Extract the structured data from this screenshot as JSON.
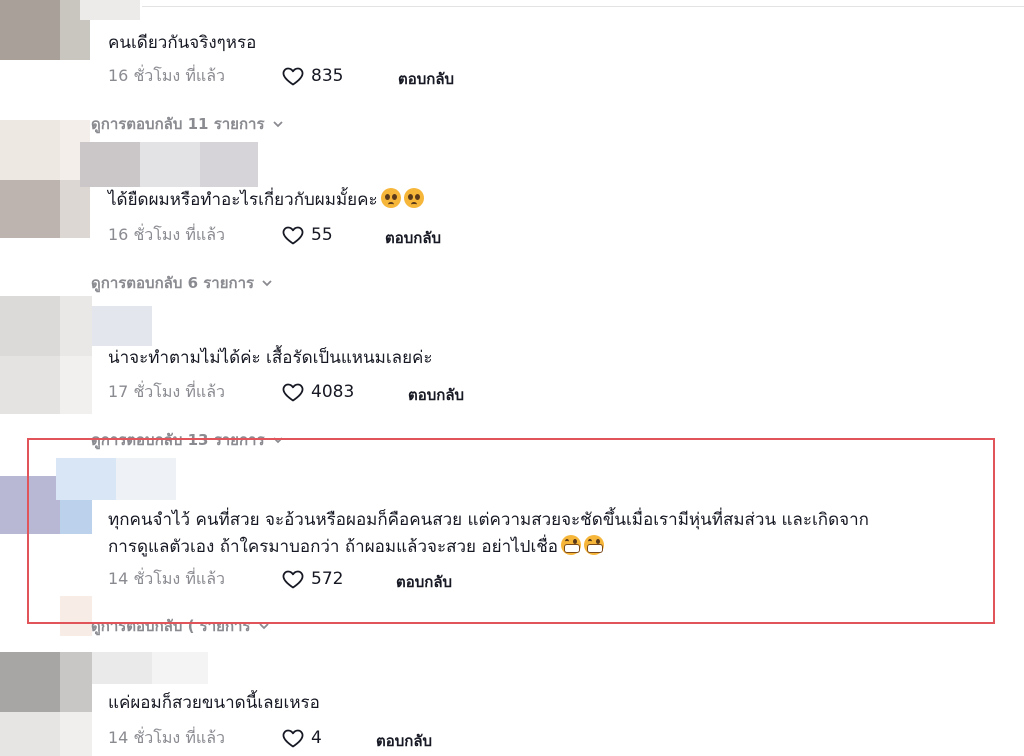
{
  "comments": [
    {
      "text": "คนเดียวกันจริงๆหรอ",
      "time": "16 ชั่วโมง ที่แล้ว",
      "likes": "835",
      "reply_label": "ตอบกลับ",
      "view_replies": "ดูการตอบกลับ 11 รายการ"
    },
    {
      "text": "ได้ยืดผมหรือทำอะไรเกี่ยวกับผมมั้ยคะ",
      "emojis": [
        "pleading-face",
        "pleading-face"
      ],
      "time": "16 ชั่วโมง ที่แล้ว",
      "likes": "55",
      "reply_label": "ตอบกลับ",
      "view_replies": "ดูการตอบกลับ 6 รายการ"
    },
    {
      "text": "น่าจะทำตามไม่ได้ค่ะ เสื้อรัดเป็นแหนมเลยค่ะ",
      "time": "17 ชั่วโมง ที่แล้ว",
      "likes": "4083",
      "reply_label": "ตอบกลับ",
      "view_replies": "ดูการตอบกลับ 13 รายการ"
    },
    {
      "text_line1": "ทุกคนจำไว้ คนที่สวย จะอ้วนหรือผอมก็คือคนสวย แต่ความสวยจะชัดขึ้นเมื่อเรามีหุ่นที่สมส่วน และเกิดจาก",
      "text_line2": "การดูแลตัวเอง ถ้าใครมาบอกว่า ถ้าผอมแล้วจะสวย อย่าไปเชื่อ",
      "emojis": [
        "grinning-face",
        "grinning-face"
      ],
      "time": "14 ชั่วโมง ที่แล้ว",
      "likes": "572",
      "reply_label": "ตอบกลับ",
      "view_replies": "ดูการตอบกลับ ( รายการ",
      "highlighted": true
    },
    {
      "text": "แค่ผอมก็สวยขนาดนี้เลยเหรอ",
      "time": "14 ชั่วโมง ที่แล้ว",
      "likes": "4",
      "reply_label": "ตอบกลับ"
    }
  ],
  "colors": {
    "text_primary": "#161823",
    "text_secondary": "#8a8b91",
    "highlight_border": "#e0545a"
  },
  "icons": [
    "heart-outline-icon",
    "chevron-down-icon"
  ]
}
